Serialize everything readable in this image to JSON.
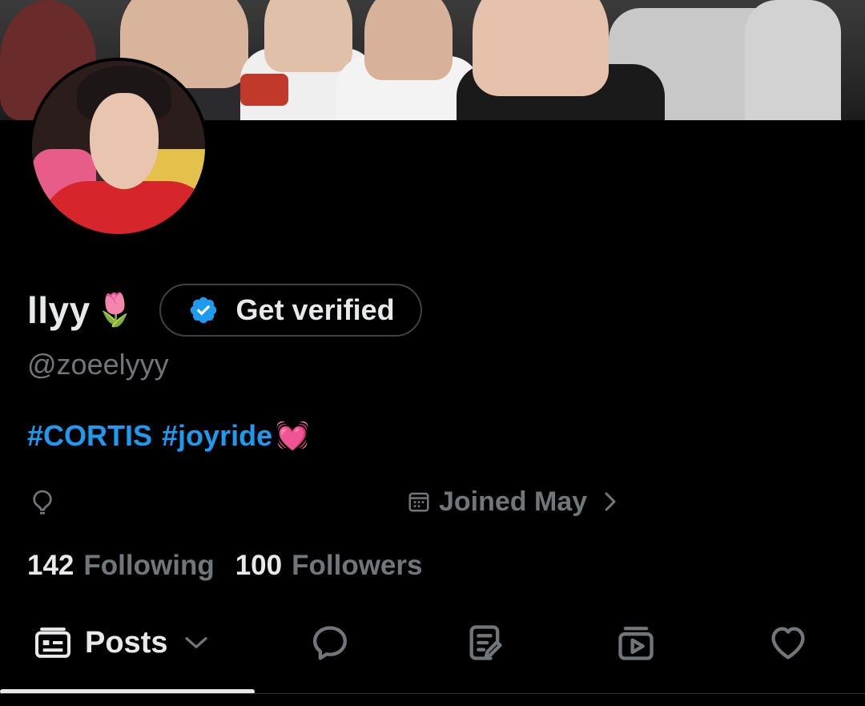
{
  "profile": {
    "display_name": "llyy",
    "name_emoji": "🌷",
    "handle": "@zoeelyyy",
    "verify_button_label": "Get verified",
    "bio_hashtags": [
      "#CORTIS",
      "#joyride"
    ],
    "bio_emoji": "💓",
    "joined_label": "Joined May",
    "following_count": "142",
    "following_label": "Following",
    "followers_count": "100",
    "followers_label": "Followers"
  },
  "tabs": {
    "posts_label": "Posts"
  },
  "icons": {
    "verify": "verified-badge-icon",
    "location": "location-pin-icon",
    "calendar": "calendar-icon",
    "chevron_right": "chevron-right-icon",
    "posts": "posts-icon",
    "chevron_down": "chevron-down-icon",
    "replies": "reply-bubble-icon",
    "articles": "articles-icon",
    "media": "media-icon",
    "likes": "heart-icon"
  },
  "colors": {
    "background": "#000000",
    "primary_text": "#e7e9ea",
    "secondary_text": "#71767b",
    "accent_blue": "#1d9bf0"
  }
}
